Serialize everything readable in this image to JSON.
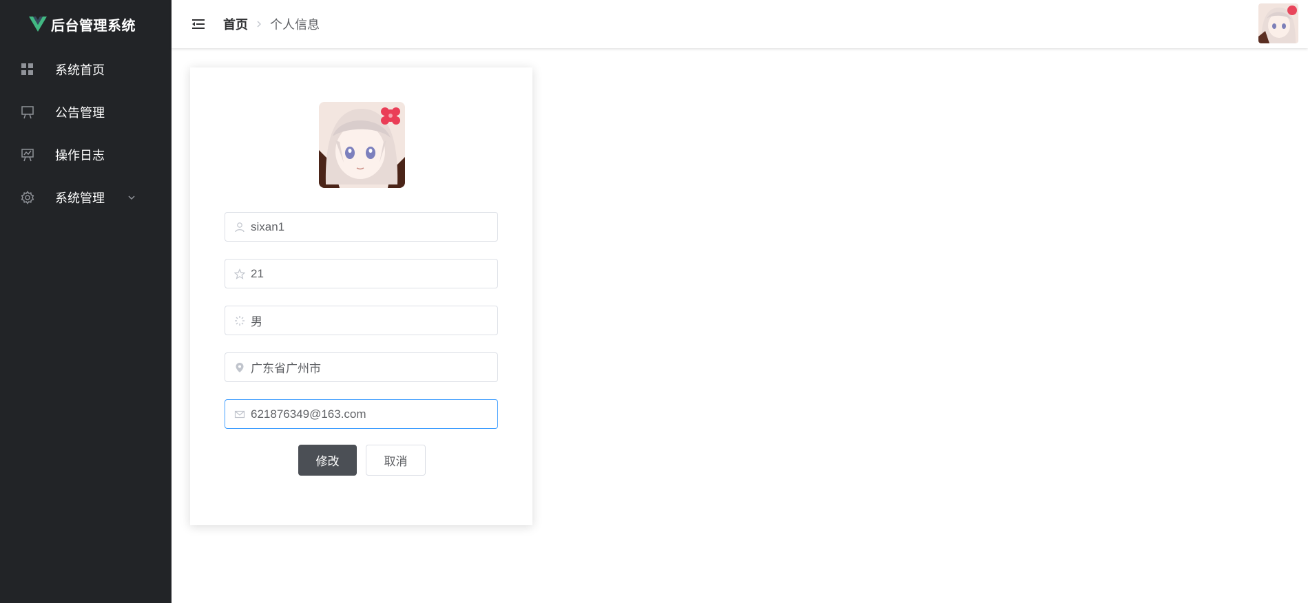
{
  "app": {
    "title": "后台管理系统",
    "brand_color": "#42b883",
    "sidebar_bg": "#222427"
  },
  "sidebar": {
    "items": [
      {
        "label": "系统首页",
        "icon": "grid-icon"
      },
      {
        "label": "公告管理",
        "icon": "presentation-board-icon"
      },
      {
        "label": "操作日志",
        "icon": "chart-board-icon"
      },
      {
        "label": "系统管理",
        "icon": "gear-icon",
        "has_submenu": true
      }
    ]
  },
  "header": {
    "breadcrumb": {
      "home": "首页",
      "current": "个人信息"
    }
  },
  "profile_form": {
    "username": {
      "value": "sixan1",
      "icon": "user-icon"
    },
    "age": {
      "value": "21",
      "icon": "star-icon"
    },
    "gender": {
      "value": "男",
      "icon": "sunny-icon"
    },
    "address": {
      "value": "广东省广州市",
      "icon": "location-icon"
    },
    "email": {
      "value": "621876349@163.com",
      "icon": "mail-icon"
    },
    "submit_label": "修改",
    "cancel_label": "取消"
  },
  "colors": {
    "input_border": "#dcdfe6",
    "input_focus_border": "#409eff",
    "primary_button": "#4b4f55"
  }
}
